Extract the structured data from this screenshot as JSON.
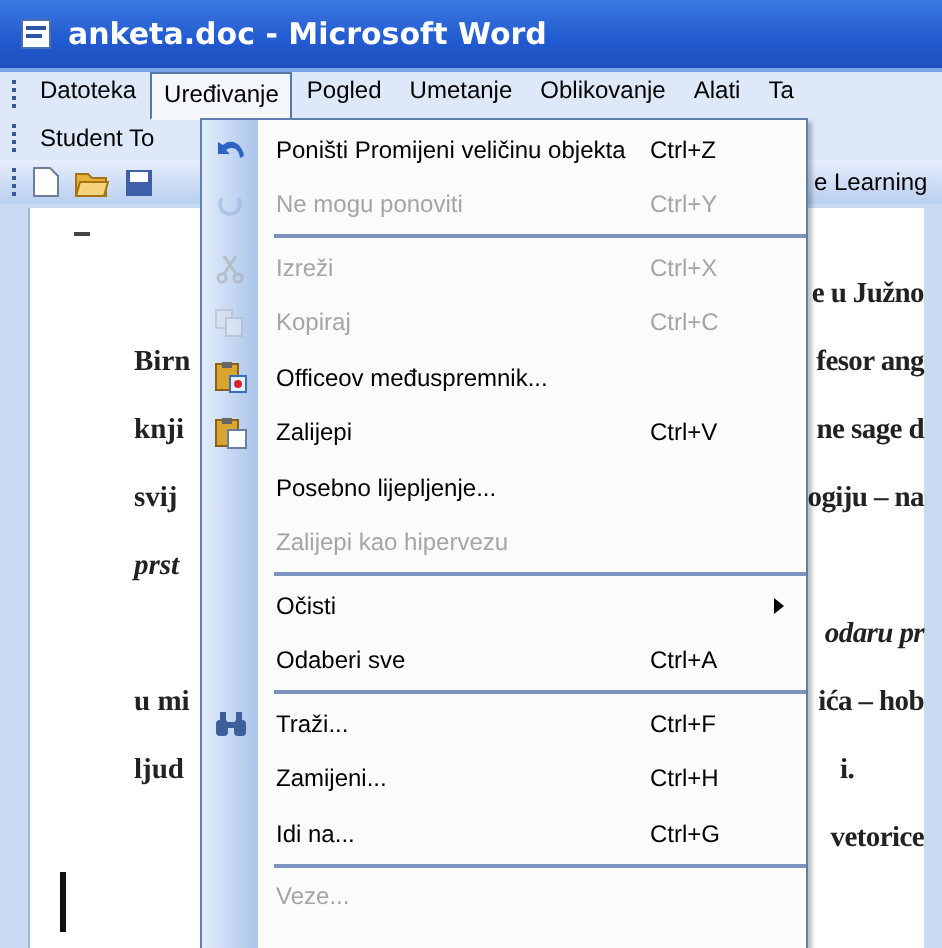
{
  "window": {
    "title": "anketa.doc - Microsoft Word"
  },
  "menubar": {
    "items": [
      {
        "label": "Datoteka",
        "selected": false
      },
      {
        "label": "Uređivanje",
        "selected": true
      },
      {
        "label": "Pogled",
        "selected": false
      },
      {
        "label": "Umetanje",
        "selected": false
      },
      {
        "label": "Oblikovanje",
        "selected": false
      },
      {
        "label": "Alati",
        "selected": false
      },
      {
        "label": "Ta",
        "selected": false
      }
    ],
    "second_row": "Student To"
  },
  "toolbar": {
    "label": "e Learning"
  },
  "document": {
    "lines": [
      {
        "right": "e u Južno",
        "italic": false
      },
      {
        "left": "Birn",
        "right": "fesor ang",
        "italic": false
      },
      {
        "left": "knji",
        "right": "ne sage d",
        "italic": false
      },
      {
        "left": "svij",
        "right": "ogiju – na",
        "italic": false
      },
      {
        "left": "prst",
        "italic": true
      },
      {
        "right": "odaru pr",
        "italic": true
      },
      {
        "left": "u mi",
        "right": "ića – hob",
        "italic": false
      },
      {
        "left": "ljud",
        "right": "i.",
        "italic": false
      },
      {
        "right": "vetorice",
        "italic": false
      }
    ]
  },
  "menu": {
    "items": [
      {
        "kind": "item",
        "label": "Poništi Promijeni veličinu objekta",
        "shortcut": "Ctrl+Z",
        "disabled": false
      },
      {
        "kind": "item",
        "label": "Ne mogu ponoviti",
        "shortcut": "Ctrl+Y",
        "disabled": true
      },
      {
        "kind": "separator"
      },
      {
        "kind": "item",
        "label": "Izreži",
        "shortcut": "Ctrl+X",
        "disabled": true
      },
      {
        "kind": "item",
        "label": "Kopiraj",
        "shortcut": "Ctrl+C",
        "disabled": true
      },
      {
        "kind": "item",
        "label": "Officeov međuspremnik...",
        "disabled": false
      },
      {
        "kind": "item",
        "label": "Zalijepi",
        "shortcut": "Ctrl+V",
        "disabled": false
      },
      {
        "kind": "item",
        "label": "Posebno lijepljenje...",
        "disabled": false
      },
      {
        "kind": "item",
        "label": "Zalijepi kao hipervezu",
        "disabled": true
      },
      {
        "kind": "separator"
      },
      {
        "kind": "item",
        "label": "Očisti",
        "disabled": false,
        "submenu": true
      },
      {
        "kind": "item",
        "label": "Odaberi sve",
        "shortcut": "Ctrl+A",
        "disabled": false
      },
      {
        "kind": "separator"
      },
      {
        "kind": "item",
        "label": "Traži...",
        "shortcut": "Ctrl+F",
        "disabled": false
      },
      {
        "kind": "item",
        "label": "Zamijeni...",
        "shortcut": "Ctrl+H",
        "disabled": false
      },
      {
        "kind": "item",
        "label": "Idi na...",
        "shortcut": "Ctrl+G",
        "disabled": false
      },
      {
        "kind": "separator"
      },
      {
        "kind": "item",
        "label": "Veze...",
        "disabled": true
      }
    ]
  }
}
